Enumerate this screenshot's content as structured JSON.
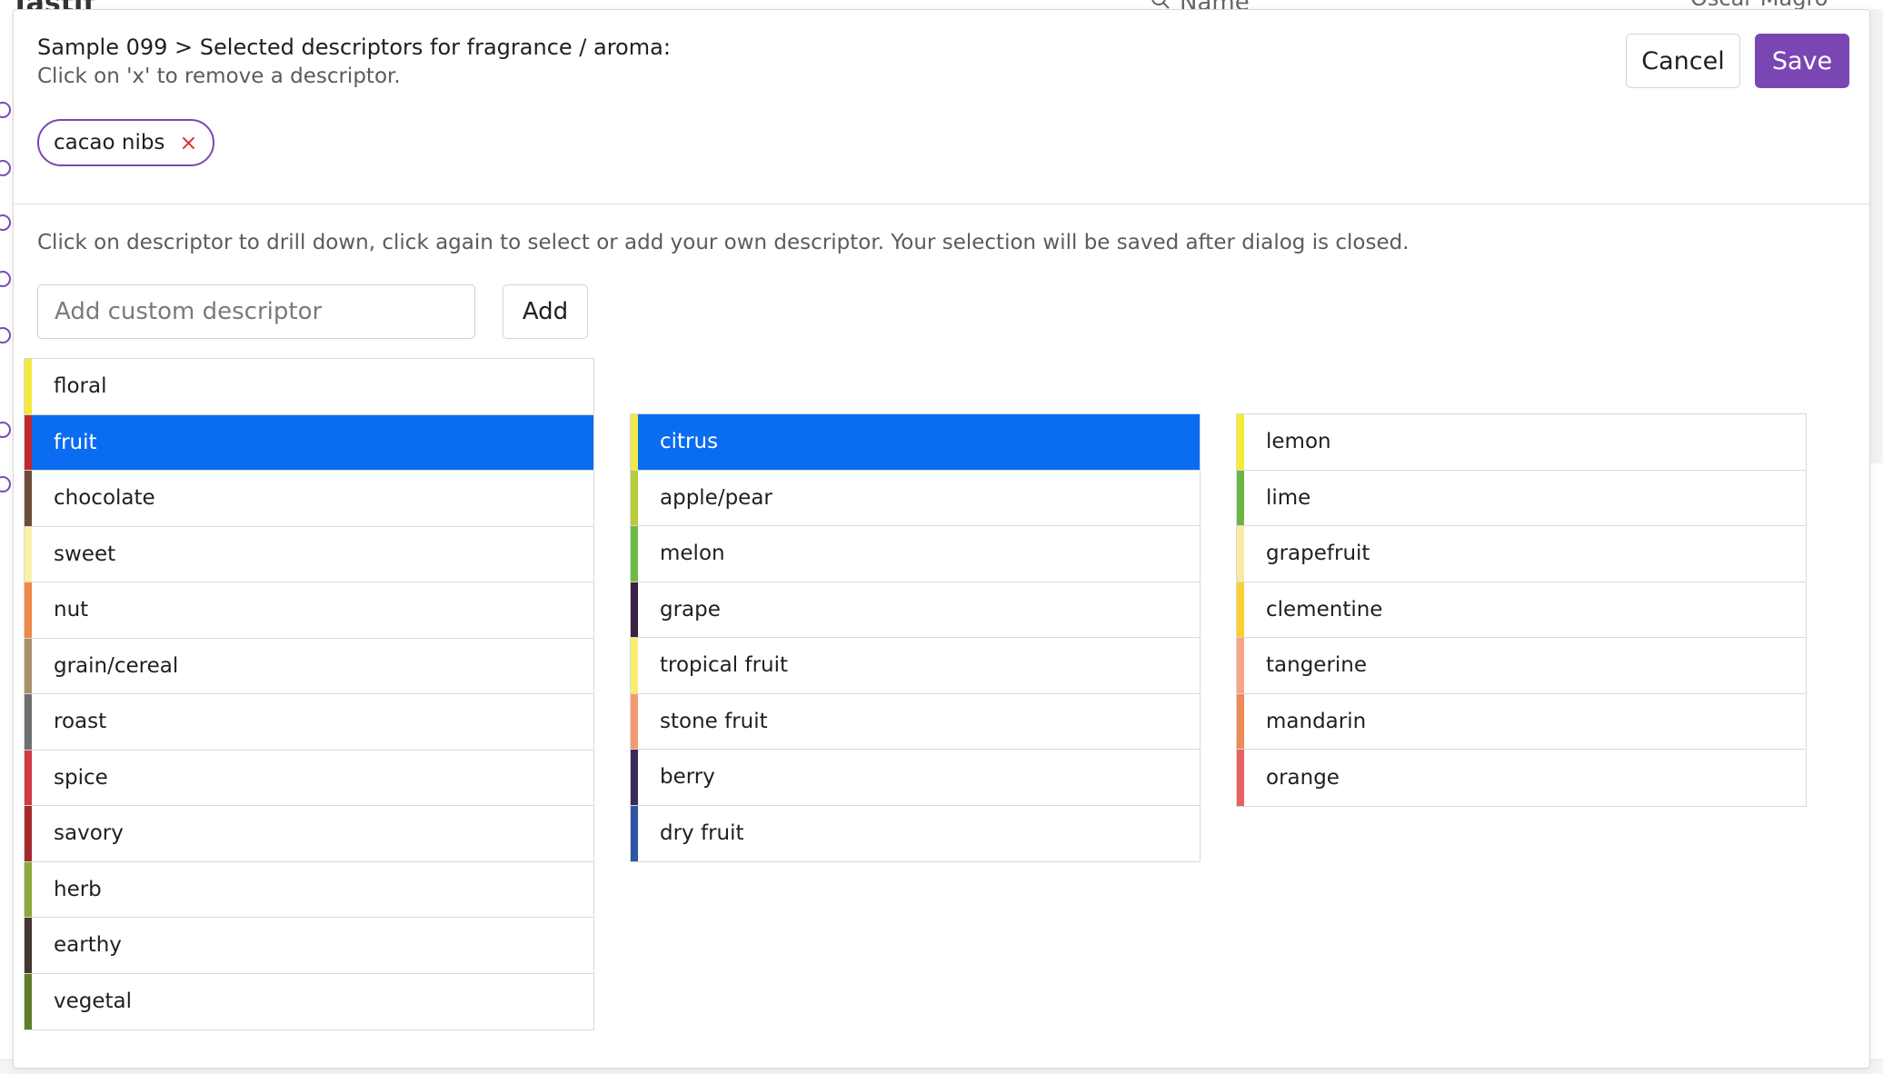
{
  "background": {
    "logo_text": "Tastif",
    "search_label": "Name",
    "user_name": "Oscar Magro"
  },
  "dialog": {
    "title": "Sample 099 > Selected descriptors for fragrance / aroma:",
    "subtitle": "Click on 'x' to remove a descriptor.",
    "cancel_label": "Cancel",
    "save_label": "Save",
    "selected_chips": [
      {
        "label": "cacao nibs",
        "remove_icon": "×"
      }
    ],
    "instruction": "Click on descriptor to drill down, click again to select or add your own descriptor. Your selection will be saved after dialog is closed.",
    "custom_input": {
      "value": "",
      "placeholder": "Add custom descriptor"
    },
    "add_label": "Add"
  },
  "colors": {
    "brand_purple": "#7a46b3",
    "selection_blue": "#0a6cf0",
    "remove_red": "#d83232"
  },
  "columns": [
    {
      "selected": "fruit",
      "items": [
        {
          "label": "floral",
          "color": "#f2e93c"
        },
        {
          "label": "fruit",
          "color": "#c0282d"
        },
        {
          "label": "chocolate",
          "color": "#6b4b3a"
        },
        {
          "label": "sweet",
          "color": "#fbf1a5"
        },
        {
          "label": "nut",
          "color": "#f0884a"
        },
        {
          "label": "grain/cereal",
          "color": "#a89169"
        },
        {
          "label": "roast",
          "color": "#6f6f6f"
        },
        {
          "label": "spice",
          "color": "#cf3a40"
        },
        {
          "label": "savory",
          "color": "#a62a2c"
        },
        {
          "label": "herb",
          "color": "#8ca83a"
        },
        {
          "label": "earthy",
          "color": "#443732"
        },
        {
          "label": "vegetal",
          "color": "#5f7d2b"
        }
      ]
    },
    {
      "selected": "citrus",
      "items": [
        {
          "label": "citrus",
          "color": "#f2e84a"
        },
        {
          "label": "apple/pear",
          "color": "#b8cc3a"
        },
        {
          "label": "melon",
          "color": "#6dbb45"
        },
        {
          "label": "grape",
          "color": "#3a2145"
        },
        {
          "label": "tropical fruit",
          "color": "#f6ee6e"
        },
        {
          "label": "stone fruit",
          "color": "#f39a73"
        },
        {
          "label": "berry",
          "color": "#3a2a5a"
        },
        {
          "label": "dry fruit",
          "color": "#2e56a8"
        }
      ]
    },
    {
      "selected": "",
      "items": [
        {
          "label": "lemon",
          "color": "#f5ea34"
        },
        {
          "label": "lime",
          "color": "#6ab544"
        },
        {
          "label": "grapefruit",
          "color": "#f8e9a3"
        },
        {
          "label": "clementine",
          "color": "#fad02d"
        },
        {
          "label": "tangerine",
          "color": "#f6a582"
        },
        {
          "label": "mandarin",
          "color": "#ee8a55"
        },
        {
          "label": "orange",
          "color": "#e9625e"
        }
      ]
    }
  ]
}
